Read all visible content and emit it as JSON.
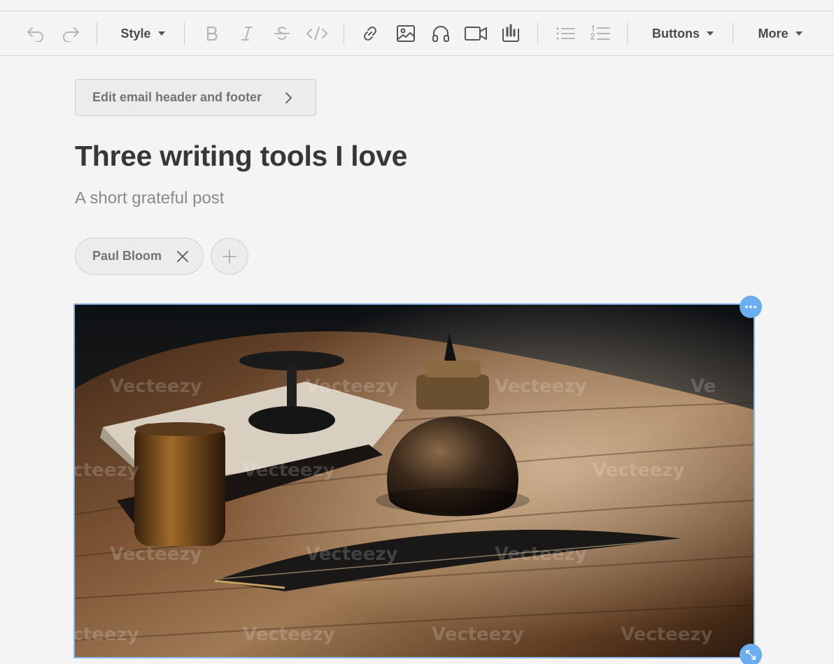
{
  "toolbar": {
    "style_label": "Style",
    "buttons_label": "Buttons",
    "more_label": "More",
    "icons": [
      "undo-icon",
      "redo-icon",
      "bold-icon",
      "italic-icon",
      "strikethrough-icon",
      "code-icon",
      "link-icon",
      "image-icon",
      "audio-icon",
      "video-icon",
      "poll-icon",
      "bullet-list-icon",
      "numbered-list-icon"
    ]
  },
  "post": {
    "header_footer_button": "Edit email header and footer",
    "title": "Three writing tools I love",
    "subtitle": "A short grateful post",
    "authors": [
      "Paul Bloom"
    ]
  },
  "image": {
    "description_icon": "photo-inkwell-quill",
    "watermark": "Vecteezy"
  },
  "colors": {
    "accent": "#6aaef0",
    "selection_border": "#8bb8ec",
    "background": "#f4f4f4",
    "title": "#363737"
  }
}
